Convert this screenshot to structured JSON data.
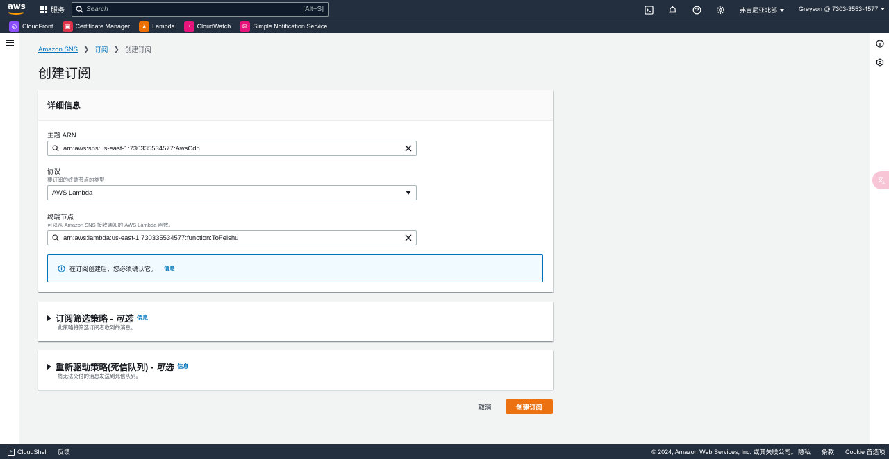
{
  "topnav": {
    "logo_text": "aws",
    "services_label": "服务",
    "search_placeholder": "Search",
    "search_shortcut": "[Alt+S]",
    "region": "弗吉尼亚北部",
    "account": "Greyson @ 7303-3553-4577",
    "icons": [
      "cloudshell-icon",
      "notifications-icon",
      "help-icon",
      "settings-icon"
    ]
  },
  "favorites": [
    {
      "label": "CloudFront",
      "color": "#8c4fff",
      "glyph": "◎"
    },
    {
      "label": "Certificate Manager",
      "color": "#dd344c",
      "glyph": "▣"
    },
    {
      "label": "Lambda",
      "color": "#ed7100",
      "glyph": "λ"
    },
    {
      "label": "CloudWatch",
      "color": "#e7157b",
      "glyph": "◔"
    },
    {
      "label": "Simple Notification Service",
      "color": "#e7157b",
      "glyph": "✉"
    }
  ],
  "breadcrumb": {
    "item1": "Amazon SNS",
    "item2": "订阅",
    "current": "创建订阅"
  },
  "page_title": "创建订阅",
  "details": {
    "heading": "详细信息",
    "topic_arn_label": "主题 ARN",
    "topic_arn_value": "arn:aws:sns:us-east-1:730335534577:AwsCdn",
    "protocol_label": "协议",
    "protocol_desc": "要订阅的终端节点的类型",
    "protocol_value": "AWS Lambda",
    "endpoint_label": "终端节点",
    "endpoint_desc": "可以从 Amazon SNS 接收通知的 AWS Lambda 函数。",
    "endpoint_value": "arn:aws:lambda:us-east-1:730335534577:function:ToFeishu",
    "alert_text": "在订阅创建后，您必须确认它。",
    "alert_link": "信息"
  },
  "filter_policy": {
    "title": "订阅筛选策略 -",
    "optional": "可选",
    "info": "信息",
    "desc": "此策略将筛选订阅者收到的消息。"
  },
  "redrive_policy": {
    "title": "重新驱动策略(死信队列) -",
    "optional": "可选",
    "info": "信息",
    "desc": "将无法交付的消息发送到死信队列。"
  },
  "actions": {
    "cancel": "取消",
    "create": "创建订阅"
  },
  "footer": {
    "cloudshell": "CloudShell",
    "feedback": "反馈",
    "copyright": "© 2024, Amazon Web Services, Inc. 或其关联公司。",
    "privacy": "隐私",
    "terms": "条款",
    "cookie": "Cookie 首选项"
  },
  "colors": {
    "nav_bg": "#232f3e",
    "primary_button": "#ec7211",
    "link": "#0073bb",
    "alert_border": "#0073bb"
  }
}
